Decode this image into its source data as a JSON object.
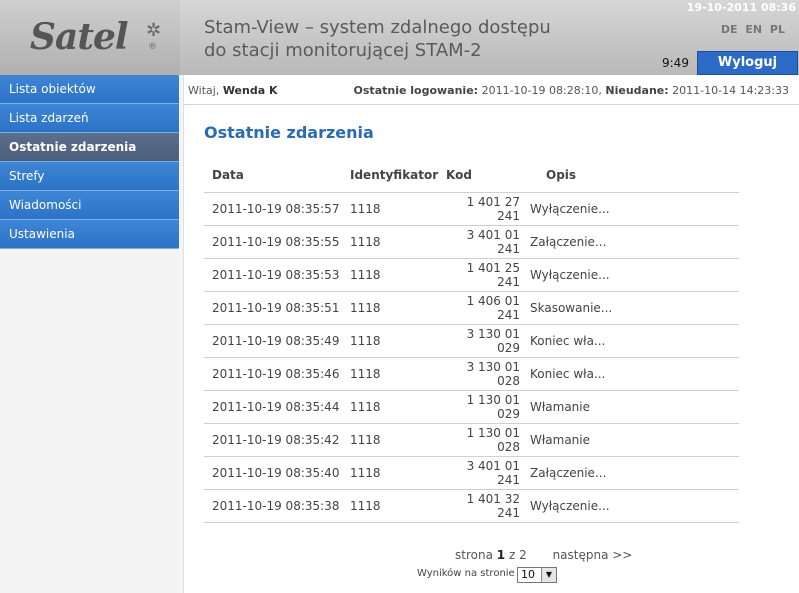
{
  "header": {
    "logo": "Satel",
    "title_line1": "Stam-View – system zdalnego dostępu",
    "title_line2": "do stacji monitorującej STAM-2",
    "datetime": "19-10-2011 08:36",
    "languages": [
      "DE",
      "EN",
      "PL"
    ],
    "clock": "9:49",
    "logout_label": "Wyloguj"
  },
  "sidebar": {
    "items": [
      {
        "label": "Lista obiektów"
      },
      {
        "label": "Lista zdarzeń"
      },
      {
        "label": "Ostatnie zdarzenia",
        "active": true
      },
      {
        "label": "Strefy"
      },
      {
        "label": "Wiadomości"
      },
      {
        "label": "Ustawienia"
      }
    ]
  },
  "topbar": {
    "welcome_prefix": "Witaj,",
    "user": "Wenda K",
    "last_login_label": "Ostatnie logowanie:",
    "last_login_value": "2011-10-19 08:28:10,",
    "failed_label": "Nieudane:",
    "failed_value": "2011-10-14 14:23:33"
  },
  "main": {
    "title": "Ostatnie zdarzenia",
    "columns": [
      "Data",
      "Identyfikator",
      "Kod",
      "Opis"
    ],
    "rows": [
      [
        "2011-10-19 08:35:57",
        "1118",
        "1 401 27 241",
        "Wyłączenie..."
      ],
      [
        "2011-10-19 08:35:55",
        "1118",
        "3 401 01 241",
        "Załączenie..."
      ],
      [
        "2011-10-19 08:35:53",
        "1118",
        "1 401 25 241",
        "Wyłączenie..."
      ],
      [
        "2011-10-19 08:35:51",
        "1118",
        "1 406 01 241",
        "Skasowanie..."
      ],
      [
        "2011-10-19 08:35:49",
        "1118",
        "3 130 01 029",
        "Koniec wła..."
      ],
      [
        "2011-10-19 08:35:46",
        "1118",
        "3 130 01 028",
        "Koniec wła..."
      ],
      [
        "2011-10-19 08:35:44",
        "1118",
        "1 130 01 029",
        "Włamanie"
      ],
      [
        "2011-10-19 08:35:42",
        "1118",
        "1 130 01 028",
        "Włamanie"
      ],
      [
        "2011-10-19 08:35:40",
        "1118",
        "3 401 01 241",
        "Załączenie..."
      ],
      [
        "2011-10-19 08:35:38",
        "1118",
        "1 401 32 241",
        "Wyłączenie..."
      ]
    ]
  },
  "pager": {
    "label": "strona",
    "current": "1",
    "separator": "z",
    "total": "2",
    "next": "następna >>",
    "per_page_label": "Wyników na stronie",
    "per_page_value": "10",
    "select_arrow_icon": "triangle-down-icon"
  }
}
